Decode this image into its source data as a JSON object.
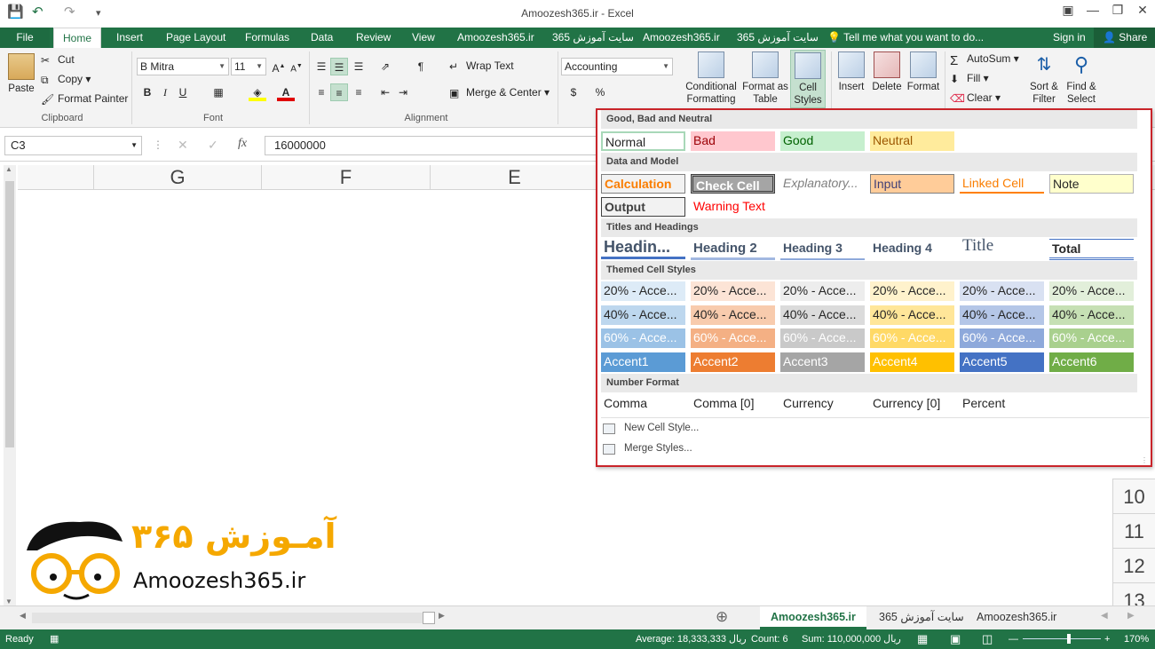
{
  "window": {
    "title": "Amoozesh365.ir - Excel"
  },
  "tabs": {
    "file": "File",
    "home": "Home",
    "insert": "Insert",
    "page_layout": "Page Layout",
    "formulas": "Formulas",
    "data": "Data",
    "review": "Review",
    "view": "View",
    "addin1": "Amoozesh365.ir",
    "addin2": "سایت آموزش 365",
    "addin3": "Amoozesh365.ir",
    "addin4": "سایت آموزش 365",
    "tell_me": "Tell me what you want to do...",
    "sign_in": "Sign in",
    "share": "Share"
  },
  "ribbon": {
    "clipboard": {
      "paste": "Paste",
      "cut": "Cut",
      "copy": "Copy",
      "format_painter": "Format Painter",
      "label": "Clipboard"
    },
    "font": {
      "name": "B Mitra",
      "size": "11",
      "label": "Font"
    },
    "alignment": {
      "wrap_text": "Wrap Text",
      "merge_center": "Merge & Center",
      "label": "Alignment"
    },
    "number": {
      "format": "Accounting"
    },
    "styles": {
      "conditional_formatting": "Conditional Formatting",
      "format_as_table": "Format as Table",
      "cell_styles": "Cell Styles"
    },
    "cells": {
      "insert": "Insert",
      "delete": "Delete",
      "format": "Format"
    },
    "editing": {
      "autosum": "AutoSum",
      "fill": "Fill",
      "clear": "Clear",
      "sort_filter": "Sort & Filter",
      "find_select": "Find & Select"
    }
  },
  "formula_bar": {
    "name_box": "C3",
    "formula": "16000000"
  },
  "columns": [
    "G",
    "F",
    "E"
  ],
  "rows": [
    "10",
    "11",
    "12",
    "13"
  ],
  "gallery": {
    "sections": {
      "good_bad": "Good, Bad and Neutral",
      "data_model": "Data and Model",
      "titles": "Titles and Headings",
      "themed": "Themed Cell Styles",
      "number_format": "Number Format"
    },
    "good_bad": [
      "Normal",
      "Bad",
      "Good",
      "Neutral"
    ],
    "data_model_row1": [
      "Calculation",
      "Check Cell",
      "Explanatory...",
      "Input",
      "Linked Cell",
      "Note"
    ],
    "data_model_row2": [
      "Output",
      "Warning Text"
    ],
    "titles": [
      "Headin...",
      "Heading 2",
      "Heading 3",
      "Heading 4",
      "Title",
      "Total"
    ],
    "themed_20": [
      "20% - Acce...",
      "20% - Acce...",
      "20% - Acce...",
      "20% - Acce...",
      "20% - Acce...",
      "20% - Acce..."
    ],
    "themed_40": [
      "40% - Acce...",
      "40% - Acce...",
      "40% - Acce...",
      "40% - Acce...",
      "40% - Acce...",
      "40% - Acce..."
    ],
    "themed_60": [
      "60% - Acce...",
      "60% - Acce...",
      "60% - Acce...",
      "60% - Acce...",
      "60% - Acce...",
      "60% - Acce..."
    ],
    "accents": [
      "Accent1",
      "Accent2",
      "Accent3",
      "Accent4",
      "Accent5",
      "Accent6"
    ],
    "number_format": [
      "Comma",
      "Comma [0]",
      "Currency",
      "Currency [0]",
      "Percent"
    ],
    "new_style": "New Cell Style...",
    "merge_styles": "Merge Styles..."
  },
  "sheets": {
    "active": "Amoozesh365.ir",
    "tab2": "سایت آموزش 365",
    "tab3": "Amoozesh365.ir"
  },
  "status": {
    "ready": "Ready",
    "average": "Average: 18,333,333 ریال",
    "count": "Count: 6",
    "sum": "Sum: 110,000,000 ریال",
    "zoom": "170%"
  },
  "logo": {
    "persian": "آمـوزش ۳۶۵",
    "latin": "Amoozesh365.ir"
  },
  "colors": {
    "excel_green": "#217346",
    "highlight_border": "#c9242a"
  }
}
